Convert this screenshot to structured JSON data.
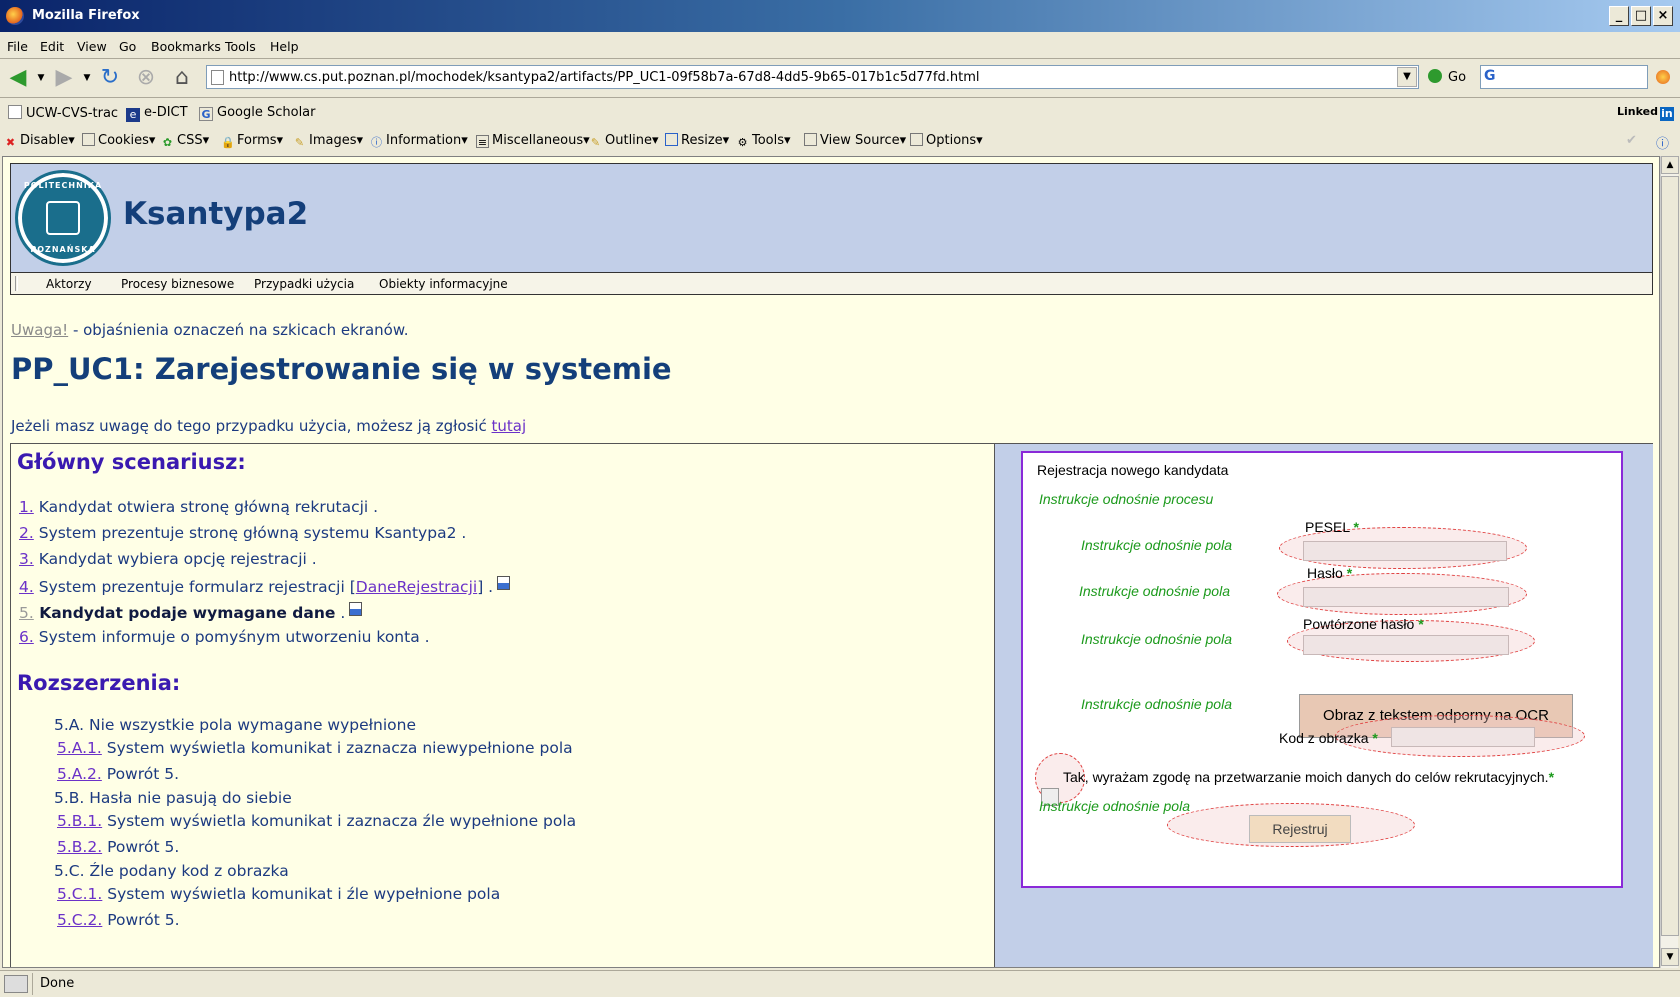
{
  "window": {
    "title": "Mozilla Firefox",
    "min": "_",
    "max": "□",
    "close": "×"
  },
  "menu": [
    "File",
    "Edit",
    "View",
    "Go",
    "Bookmarks",
    "Tools",
    "Help"
  ],
  "nav": {
    "url": "http://www.cs.put.poznan.pl/mochodek/ksantypa2/artifacts/PP_UC1-09f58b7a-67d8-4dd5-9b65-017b1c5d77fd.html",
    "go": "Go",
    "search_value": "G"
  },
  "bookmarks": [
    "UCW-CVS-trac",
    "e-DICT",
    "Google Scholar"
  ],
  "linkedin": "Linked",
  "webdev": [
    "Disable",
    "Cookies",
    "CSS",
    "Forms",
    "Images",
    "Information",
    "Miscellaneous",
    "Outline",
    "Resize",
    "Tools",
    "View Source",
    "Options"
  ],
  "site": {
    "title": "Ksantypa2",
    "logo_top": "POLITECHNIKA",
    "logo_bottom": "POZNAŃSKA",
    "nav": [
      "Aktorzy",
      "Procesy biznesowe",
      "Przypadki użycia",
      "Obiekty informacyjne"
    ]
  },
  "note": {
    "link": "Uwaga!",
    "text": " - objaśnienia oznaczeń na szkicach ekranów."
  },
  "heading": "PP_UC1: Zarejestrowanie się w systemie",
  "remark": {
    "text": "Jeżeli masz uwagę do tego przypadku użycia, możesz ją zgłosić ",
    "link": "tutaj"
  },
  "main_title": "Główny scenariusz:",
  "steps": [
    {
      "num": "1.",
      "text": " Kandydat otwiera stronę główną rekrutacji ."
    },
    {
      "num": "2.",
      "text": " System prezentuje stronę główną systemu Ksantypa2 ."
    },
    {
      "num": "3.",
      "text": " Kandydat wybiera opcję rejestracji ."
    },
    {
      "num": "4.",
      "text_a": " System prezentuje formularz rejestracji [",
      "link": "DaneRejestracji",
      "text_b": "] ."
    },
    {
      "num": "5.",
      "text": " Kandydat podaje wymagane dane",
      "after": " ."
    },
    {
      "num": "6.",
      "text": " System informuje o pomyśnym utworzeniu konta ."
    }
  ],
  "ext_title": "Rozszerzenia:",
  "extensions": [
    {
      "head": "5.A. Nie wszystkie pola wymagane wypełnione",
      "items": [
        {
          "num": "5.A.1.",
          "text": " System wyświetla komunikat i zaznacza niewypełnione pola"
        },
        {
          "num": "5.A.2.",
          "text": " Powrót 5."
        }
      ]
    },
    {
      "head": "5.B. Hasła nie pasują do siebie",
      "items": [
        {
          "num": "5.B.1.",
          "text": " System wyświetla komunikat i zaznacza źle wypełnione pola"
        },
        {
          "num": "5.B.2.",
          "text": " Powrót 5."
        }
      ]
    },
    {
      "head": "5.C. Źle podany kod z obrazka",
      "items": [
        {
          "num": "5.C.1.",
          "text": " System wyświetla komunikat i źle wypełnione pola"
        },
        {
          "num": "5.C.2.",
          "text": " Powrót 5."
        }
      ]
    }
  ],
  "mockup": {
    "title": "Rejestracja nowego kandydata",
    "process_instr": "Instrukcje odnośnie procesu",
    "field_instr": "Instrukcje odnośnie pola",
    "pesel": "PESEL",
    "haslo": "Hasło",
    "powt": "Powtórzone hasło",
    "ocr": "Obraz z tekstem odporny na OCR",
    "kod": "Kod z obrazka",
    "consent": "Tak, wyrażam zgodę na przetwarzanie moich danych do celów rekrutacyjnych.",
    "star": "*",
    "submit": "Rejestruj"
  },
  "status": "Done"
}
